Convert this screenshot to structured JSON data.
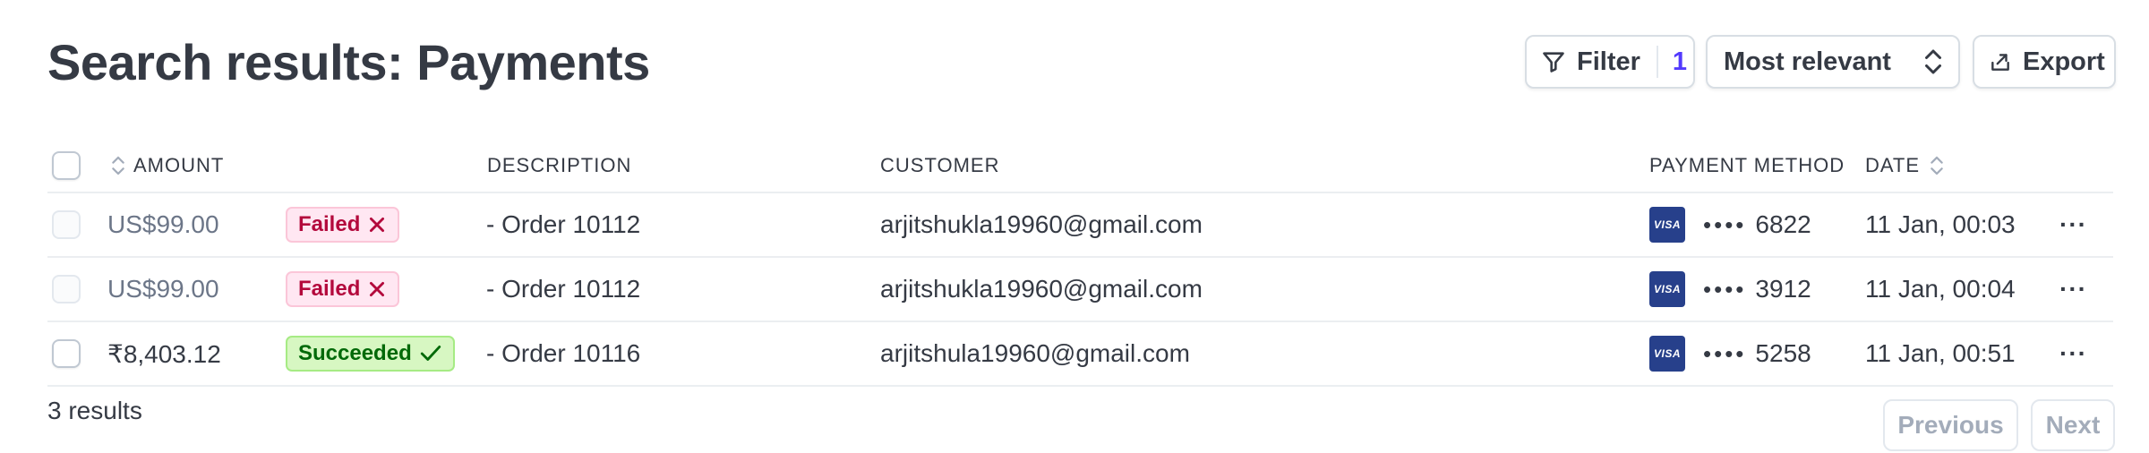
{
  "page": {
    "title": "Search results: Payments"
  },
  "toolbar": {
    "filter_label": "Filter",
    "filter_count": "1",
    "sort_value": "Most relevant",
    "export_label": "Export"
  },
  "table": {
    "columns": {
      "amount": "AMOUNT",
      "description": "DESCRIPTION",
      "customer": "CUSTOMER",
      "payment_method": "PAYMENT METHOD",
      "date": "DATE"
    },
    "rows": [
      {
        "amount": "US$99.00",
        "status": "Failed",
        "description": "- Order 10112",
        "customer": "arjitshukla19960@gmail.com",
        "card_brand": "VISA",
        "card_mask": "••••",
        "card_last4": "6822",
        "date": "11 Jan, 00:03",
        "more": "···"
      },
      {
        "amount": "US$99.00",
        "status": "Failed",
        "description": "- Order 10112",
        "customer": "arjitshukla19960@gmail.com",
        "card_brand": "VISA",
        "card_mask": "••••",
        "card_last4": "3912",
        "date": "11 Jan, 00:04",
        "more": "···"
      },
      {
        "amount": "₹8,403.12",
        "status": "Succeeded",
        "description": "- Order 10116",
        "customer": "arjitshula19960@gmail.com",
        "card_brand": "VISA",
        "card_mask": "••••",
        "card_last4": "5258",
        "date": "11 Jan, 00:51",
        "more": "···"
      }
    ]
  },
  "footer": {
    "results_count": "3 results",
    "previous_label": "Previous",
    "next_label": "Next"
  },
  "colors": {
    "accent": "#533afd",
    "failed_text": "#b3093c",
    "failed_bg": "#ffe7f2",
    "succeeded_text": "#006908",
    "succeeded_bg": "#d7f7c2",
    "visa_blue": "#27408b"
  },
  "icons": {
    "filter": "funnel-icon",
    "sort": "chevron-up-down-icon",
    "export": "export-icon",
    "failed": "x-icon",
    "succeeded": "check-icon"
  }
}
